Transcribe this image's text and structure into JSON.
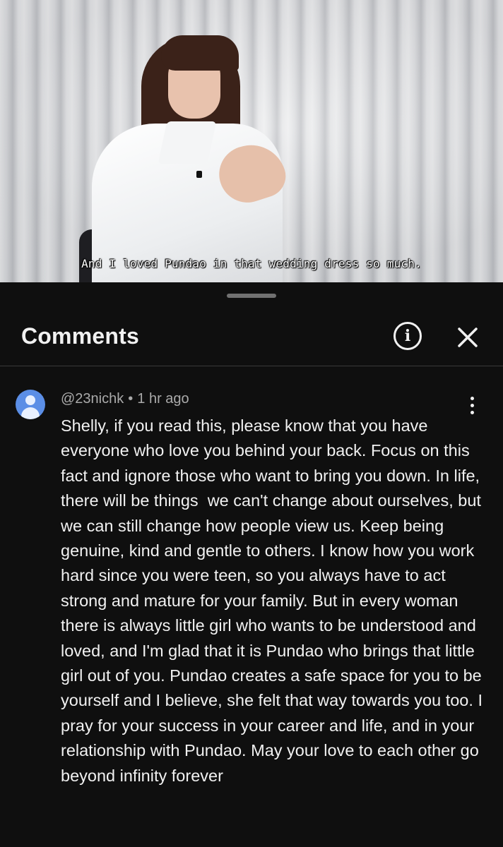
{
  "video": {
    "subtitle": "And I loved Pundao in that wedding dress so much."
  },
  "comments_panel": {
    "title": "Comments",
    "info_icon": "info-icon",
    "close_icon": "close-icon"
  },
  "comment": {
    "author": "@23nichk",
    "separator": "•",
    "time": "1 hr ago",
    "avatar_color": "#5b8ee6",
    "text": "Shelly, if you read this, please know that you have everyone who love you behind your back. Focus on this fact and ignore those who want to bring you down. In life, there will be things  we can't change about ourselves, but we can still change how people view us. Keep being genuine, kind and gentle to others. I know how you work hard since you were teen, so you always have to act strong and mature for your family. But in every woman there is always little girl who wants to be understood and loved, and I'm glad that it is Pundao who brings that little girl out of you. Pundao creates a safe space for you to be yourself and I believe, she felt that way towards you too. I pray for your success in your career and life, and in your relationship with Pundao. May your love to each other go beyond infinity forever"
  }
}
